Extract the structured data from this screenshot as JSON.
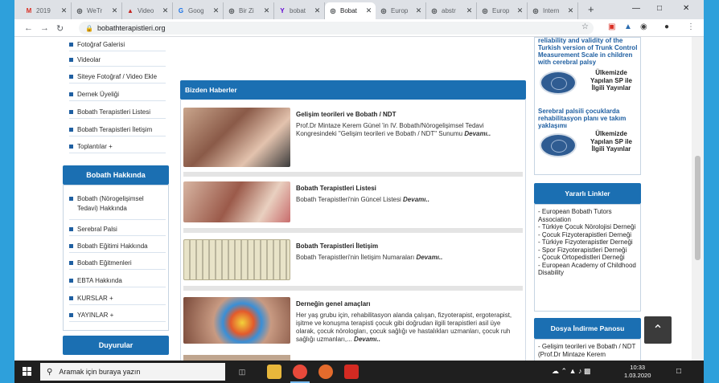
{
  "browser": {
    "tabs": [
      {
        "label": "2019",
        "icon": "gmail-icon",
        "color": "#d93025",
        "glyph": "M"
      },
      {
        "label": "WeTr",
        "icon": "globe-icon",
        "color": "#3c4043",
        "glyph": "◎"
      },
      {
        "label": "Video",
        "icon": "video-icon",
        "color": "#c5221f",
        "glyph": "▲"
      },
      {
        "label": "Goog",
        "icon": "translate-icon",
        "color": "#1a73e8",
        "glyph": "G"
      },
      {
        "label": "Bir Zi",
        "icon": "globe-icon",
        "color": "#3c4043",
        "glyph": "◎"
      },
      {
        "label": "bobat",
        "icon": "yahoo-icon",
        "color": "#6001d2",
        "glyph": "Y"
      },
      {
        "label": "Bobat",
        "icon": "globe-icon",
        "color": "#3c4043",
        "glyph": "◎",
        "active": true
      },
      {
        "label": "Europ",
        "icon": "globe-icon",
        "color": "#3c4043",
        "glyph": "◎"
      },
      {
        "label": "abstr",
        "icon": "globe-icon",
        "color": "#3c4043",
        "glyph": "◎"
      },
      {
        "label": "Europ",
        "icon": "globe-icon",
        "color": "#3c4043",
        "glyph": "◎"
      },
      {
        "label": "Intern",
        "icon": "globe-icon",
        "color": "#3c4043",
        "glyph": "◎"
      }
    ],
    "url": "bobathterapistleri.org"
  },
  "left_menu_top": [
    "Fotoğraf Galerisi",
    "Videolar",
    "Siteye Fotoğraf / Video Ekle",
    "Dernek Üyeliği",
    "Bobath Terapistleri Listesi",
    "Bobath Terapistleri İletişim",
    "Toplantılar +"
  ],
  "left_panel": {
    "title": "Bobath Hakkında",
    "items": [
      "Bobath (Nörogelişimsel Tedavi) Hakkında",
      "Serebral Palsi",
      "Bobath Eğitimi Hakkında",
      "Bobath Eğitmenleri",
      "EBTA Hakkında",
      "KURSLAR +",
      "YAYINLAR +"
    ]
  },
  "left_panel2": {
    "title": "Duyurular"
  },
  "news": {
    "title": "Bizden Haberler",
    "more": "Devamı..",
    "items": [
      {
        "title": "Gelişim teorileri ve Bobath / NDT",
        "text": "Prof.Dr Mintaze Kerem Günel 'in IV. Bobath/Nörogelişimsel Tedavi Kongresindeki \"Gelişim teorileri ve Bobath / NDT\" Sunumu"
      },
      {
        "title": "Bobath Terapistleri Listesi",
        "text": "Bobath Terapistleri'nin Güncel Listesi"
      },
      {
        "title": "Bobath Terapistleri İletişim",
        "text": "Bobath Terapistleri'nin İletişim Numaraları"
      },
      {
        "title": "Derneğin genel amaçları",
        "text": "Her yaş grubu için, rehabilitasyon alanda çalışan, fizyoterapist, ergoterapist, işitme ve konuşma terapisti  çocuk gibi doğrudan ilgili terapistleri asil üye olarak, çocuk nörologları, çocuk sağlığı ve hastalıkları uzmanları, çocuk ruh sağlığı uzmanları,..."
      }
    ]
  },
  "right_col": {
    "pub1_title": "reliability and validity of the Turkish version of Trunk Control Measurement Scale in children with cerebral palsy",
    "pub_caption": "Ülkemizde Yapılan SP ile İlgili Yayınlar",
    "pub2_title": "Serebral palsili çocuklarda rehabilitasyon planı ve takım yaklaşımı",
    "links_title": "Yararlı Linkler",
    "links": [
      "- European Bobath Tutors Association",
      "- Türkiye Çocuk Nörolojisi Derneği",
      "- Çocuk Fizyoterapistleri Derneği",
      "- Türkiye Fizyoterapistler Derneği",
      "- Spor Fizyoterapistleri Derneği",
      "- Çocuk Ortopedistleri Derneği",
      "- European Academy of Childhood Disability"
    ],
    "downloads_title": "Dosya İndirme Panosu",
    "downloads": [
      "- Gelişim teorileri ve Bobath / NDT (Prof.Dr Mintaze Kerem"
    ]
  },
  "taskbar": {
    "search_placeholder": "Aramak için buraya yazın",
    "time": "10:33",
    "date": "1.03.2020"
  },
  "colors": {
    "accent": "#1b6fb2",
    "desktop": "#2ea0db"
  }
}
